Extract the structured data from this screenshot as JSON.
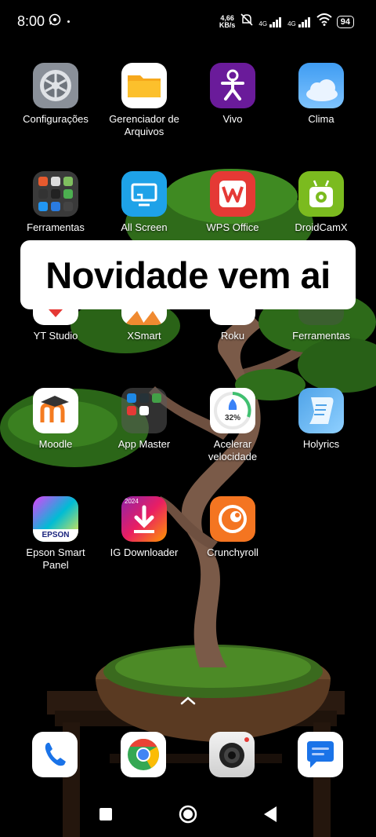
{
  "status_bar": {
    "time": "8:00",
    "net_speed_value": "4,66",
    "net_speed_unit": "KB/s",
    "signal1_label": "4G",
    "signal2_label": "4G",
    "battery": "94"
  },
  "apps": {
    "configuracoes": "Configurações",
    "gerenciador_line1": "Gerenciador de",
    "gerenciador_line2": "Arquivos",
    "vivo": "Vivo",
    "clima": "Clima",
    "ferramentas1": "Ferramentas",
    "all_screen": "All Screen",
    "wps_office": "WPS Office",
    "droidcamx": "DroidCamX",
    "yt_studio": "YT Studio",
    "xsmart": "XSmart",
    "roku": "Roku",
    "ferramentas2": "Ferramentas",
    "moodle": "Moodle",
    "app_master": "App Master",
    "acelerar_line1": "Acelerar",
    "acelerar_line2": "velocidade",
    "acelerar_percent": "32%",
    "holyrics": "Holyrics",
    "epson_line1": "Epson Smart",
    "epson_line2": "Panel",
    "epson_logo": "EPSON",
    "ig_downloader": "IG Downloader",
    "ig_year": "2024",
    "crunchyroll": "Crunchyroll"
  },
  "banner": {
    "text": "Novidade vem ai"
  },
  "dock": [
    "phone",
    "chrome",
    "camera",
    "messages"
  ]
}
